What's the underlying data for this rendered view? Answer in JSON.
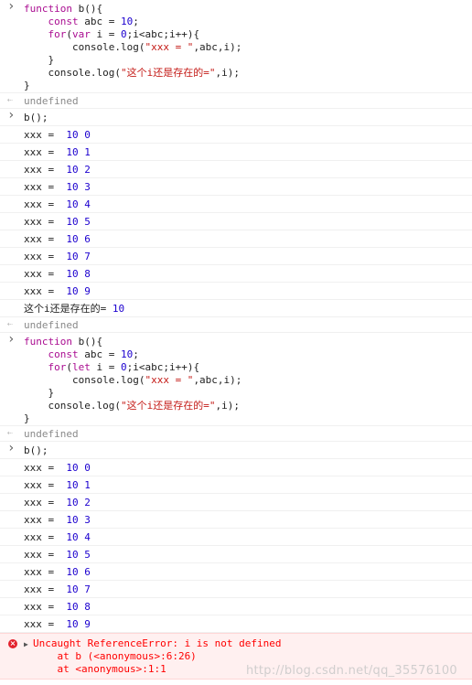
{
  "console": {
    "block1": {
      "code": [
        [
          {
            "t": "kw",
            "v": "function"
          },
          {
            "t": "plain",
            "v": " b(){"
          }
        ],
        [
          {
            "t": "plain",
            "v": "    "
          },
          {
            "t": "kw",
            "v": "const"
          },
          {
            "t": "plain",
            "v": " abc = "
          },
          {
            "t": "num",
            "v": "10"
          },
          {
            "t": "plain",
            "v": ";"
          }
        ],
        [
          {
            "t": "plain",
            "v": "    "
          },
          {
            "t": "kw",
            "v": "for"
          },
          {
            "t": "plain",
            "v": "("
          },
          {
            "t": "kw",
            "v": "var"
          },
          {
            "t": "plain",
            "v": " i = "
          },
          {
            "t": "num",
            "v": "0"
          },
          {
            "t": "plain",
            "v": ";i<abc;i++){"
          }
        ],
        [
          {
            "t": "plain",
            "v": "        console.log("
          },
          {
            "t": "str",
            "v": "\"xxx = \""
          },
          {
            "t": "plain",
            "v": ",abc,i);"
          }
        ],
        [
          {
            "t": "plain",
            "v": "    }"
          }
        ],
        [
          {
            "t": "plain",
            "v": "    console.log("
          },
          {
            "t": "str",
            "v": "\"这个i还是存在的=\""
          },
          {
            "t": "plain",
            "v": ",i);"
          }
        ],
        [
          {
            "t": "plain",
            "v": "}"
          }
        ]
      ],
      "return": "undefined"
    },
    "call1": {
      "input": "b();",
      "logs": [
        {
          "label": "xxx = ",
          "a": "10",
          "b": "0"
        },
        {
          "label": "xxx = ",
          "a": "10",
          "b": "1"
        },
        {
          "label": "xxx = ",
          "a": "10",
          "b": "2"
        },
        {
          "label": "xxx = ",
          "a": "10",
          "b": "3"
        },
        {
          "label": "xxx = ",
          "a": "10",
          "b": "4"
        },
        {
          "label": "xxx = ",
          "a": "10",
          "b": "5"
        },
        {
          "label": "xxx = ",
          "a": "10",
          "b": "6"
        },
        {
          "label": "xxx = ",
          "a": "10",
          "b": "7"
        },
        {
          "label": "xxx = ",
          "a": "10",
          "b": "8"
        },
        {
          "label": "xxx = ",
          "a": "10",
          "b": "9"
        }
      ],
      "final_log": {
        "label": "这个i还是存在的= ",
        "a": "10"
      },
      "return": "undefined"
    },
    "block2": {
      "code": [
        [
          {
            "t": "kw",
            "v": "function"
          },
          {
            "t": "plain",
            "v": " b(){"
          }
        ],
        [
          {
            "t": "plain",
            "v": "    "
          },
          {
            "t": "kw",
            "v": "const"
          },
          {
            "t": "plain",
            "v": " abc = "
          },
          {
            "t": "num",
            "v": "10"
          },
          {
            "t": "plain",
            "v": ";"
          }
        ],
        [
          {
            "t": "plain",
            "v": "    "
          },
          {
            "t": "kw",
            "v": "for"
          },
          {
            "t": "plain",
            "v": "("
          },
          {
            "t": "kw",
            "v": "let"
          },
          {
            "t": "plain",
            "v": " i = "
          },
          {
            "t": "num",
            "v": "0"
          },
          {
            "t": "plain",
            "v": ";i<abc;i++){"
          }
        ],
        [
          {
            "t": "plain",
            "v": "        console.log("
          },
          {
            "t": "str",
            "v": "\"xxx = \""
          },
          {
            "t": "plain",
            "v": ",abc,i);"
          }
        ],
        [
          {
            "t": "plain",
            "v": "    }"
          }
        ],
        [
          {
            "t": "plain",
            "v": "    console.log("
          },
          {
            "t": "str",
            "v": "\"这个i还是存在的=\""
          },
          {
            "t": "plain",
            "v": ",i);"
          }
        ],
        [
          {
            "t": "plain",
            "v": "}"
          }
        ]
      ],
      "return": "undefined"
    },
    "call2": {
      "input": "b();",
      "logs": [
        {
          "label": "xxx = ",
          "a": "10",
          "b": "0"
        },
        {
          "label": "xxx = ",
          "a": "10",
          "b": "1"
        },
        {
          "label": "xxx = ",
          "a": "10",
          "b": "2"
        },
        {
          "label": "xxx = ",
          "a": "10",
          "b": "3"
        },
        {
          "label": "xxx = ",
          "a": "10",
          "b": "4"
        },
        {
          "label": "xxx = ",
          "a": "10",
          "b": "5"
        },
        {
          "label": "xxx = ",
          "a": "10",
          "b": "6"
        },
        {
          "label": "xxx = ",
          "a": "10",
          "b": "7"
        },
        {
          "label": "xxx = ",
          "a": "10",
          "b": "8"
        },
        {
          "label": "xxx = ",
          "a": "10",
          "b": "9"
        }
      ],
      "error": {
        "message": "Uncaught ReferenceError: i is not defined",
        "stack": [
          "    at b (<anonymous>:6:26)",
          "    at <anonymous>:1:1"
        ]
      }
    }
  },
  "watermark": "http://blog.csdn.net/qq_35576100",
  "icons": {
    "prompt": "chevron-right-icon",
    "return": "return-arrow-icon",
    "error": "error-icon",
    "expand": "expand-triangle-icon"
  },
  "colors": {
    "keyword": "#aa0d91",
    "string": "#c41a16",
    "number": "#1c00cf",
    "error": "#ff0000",
    "error_bg": "#fff0f0"
  }
}
